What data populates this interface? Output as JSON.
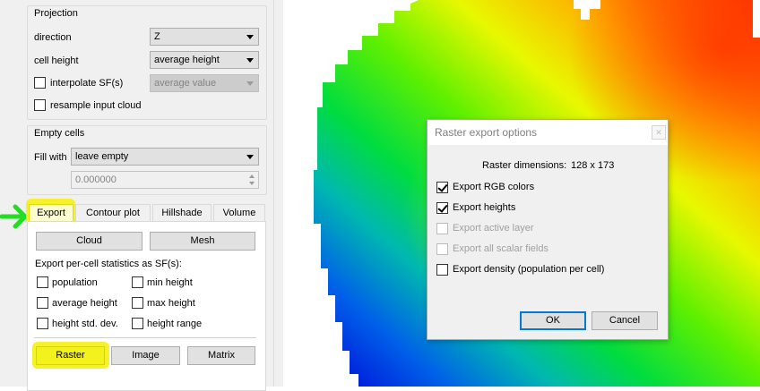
{
  "projection": {
    "title": "Projection",
    "direction_label": "direction",
    "direction_value": "Z",
    "cell_height_label": "cell height",
    "cell_height_value": "average height",
    "interpolate_label": "interpolate SF(s)",
    "interpolate_value": "average value",
    "resample_label": "resample input cloud"
  },
  "empty_cells": {
    "title": "Empty cells",
    "fill_label": "Fill with",
    "fill_value": "leave empty",
    "spin_value": "0.000000"
  },
  "tabs": [
    "Export",
    "Contour plot",
    "Hillshade",
    "Volume"
  ],
  "export_panel": {
    "cloud_btn": "Cloud",
    "mesh_btn": "Mesh",
    "stats_label": "Export per-cell statistics as SF(s):",
    "stats": {
      "population": "population",
      "min_height": "min height",
      "average_height": "average height",
      "max_height": "max height",
      "height_std": "height std. dev.",
      "height_range": "height range"
    },
    "raster_btn": "Raster",
    "image_btn": "Image",
    "matrix_btn": "Matrix"
  },
  "dialog": {
    "title": "Raster export options",
    "close": "✕",
    "dims_label": "Raster dimensions:",
    "dims_value": "128 x 173",
    "opt_rgb": "Export RGB colors",
    "opt_heights": "Export heights",
    "opt_active": "Export active layer",
    "opt_all_sf": "Export all scalar fields",
    "opt_density": "Export density (population per cell)",
    "ok": "OK",
    "cancel": "Cancel"
  },
  "colors": {
    "highlight": "#f6f12a",
    "arrow": "#22dd22",
    "focus": "#0078d7"
  }
}
